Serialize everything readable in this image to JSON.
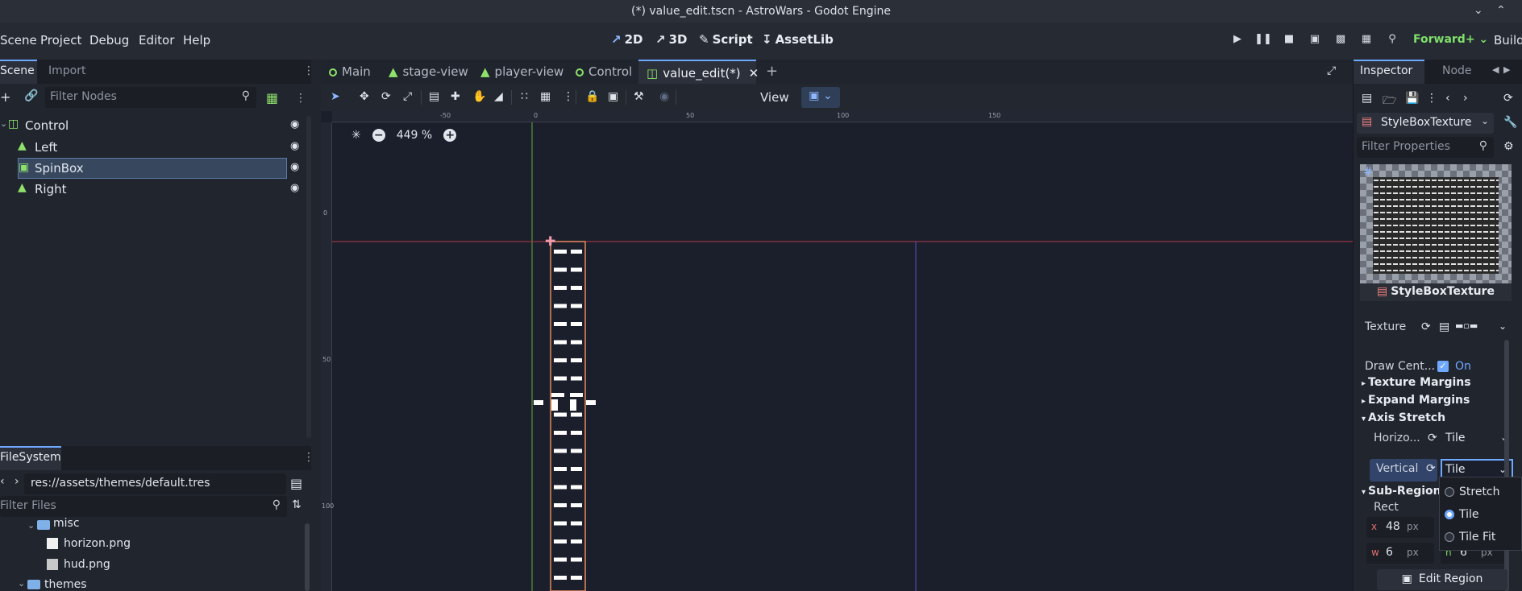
{
  "window": {
    "title": "(*) value_edit.tscn - AstroWars - Godot Engine"
  },
  "menu": {
    "items": [
      "Scene",
      "Project",
      "Debug",
      "Editor",
      "Help"
    ]
  },
  "workspaces": [
    {
      "label": "2D",
      "icon": "2d-icon"
    },
    {
      "label": "3D",
      "icon": "3d-icon"
    },
    {
      "label": "Script",
      "icon": "script-icon"
    },
    {
      "label": "AssetLib",
      "icon": "assetlib-icon"
    }
  ],
  "renderer": {
    "label": "Forward+"
  },
  "build": {
    "label": "Build"
  },
  "scene_dock": {
    "tabs": [
      "Scene",
      "Import"
    ],
    "filter_placeholder": "Filter Nodes",
    "nodes": [
      {
        "label": "Control",
        "icon": "control-node-icon",
        "depth": 0
      },
      {
        "label": "Left",
        "icon": "texture-rect-icon",
        "depth": 1
      },
      {
        "label": "SpinBox",
        "icon": "spinbox-icon",
        "depth": 1,
        "selected": true
      },
      {
        "label": "Right",
        "icon": "texture-rect-icon",
        "depth": 1
      }
    ]
  },
  "filesystem": {
    "tab": "FileSystem",
    "path": "res://assets/themes/default.tres",
    "filter_placeholder": "Filter Files",
    "items": [
      {
        "label": "misc",
        "type": "folder"
      },
      {
        "label": "horizon.png",
        "type": "image"
      },
      {
        "label": "hud.png",
        "type": "image"
      },
      {
        "label": "themes",
        "type": "folder"
      }
    ]
  },
  "scene_tabs": [
    {
      "label": "Main"
    },
    {
      "label": "stage-view"
    },
    {
      "label": "player-view"
    },
    {
      "label": "Control"
    },
    {
      "label": "value_edit(*)",
      "active": true
    }
  ],
  "editor_toolbar": {
    "view_label": "View"
  },
  "ruler": {
    "top_marks": [
      "-50",
      "0",
      "50",
      "100",
      "150"
    ],
    "left_marks": [
      "0",
      "50",
      "100"
    ]
  },
  "zoom": {
    "label": "449 %"
  },
  "inspector": {
    "tabs": [
      "Inspector",
      "Node"
    ],
    "resource": "StyleBoxTexture",
    "filter_placeholder": "Filter Properties",
    "preview_label": "StyleBoxTexture",
    "texture_label": "Texture",
    "draw_center": {
      "label": "Draw Cent...",
      "value": "On"
    },
    "sections": {
      "texture_margins": "Texture Margins",
      "expand_margins": "Expand Margins",
      "axis_stretch": "Axis Stretch",
      "sub_region": "Sub-Region"
    },
    "horizontal": {
      "label": "Horizo...",
      "value": "Tile"
    },
    "vertical": {
      "label": "Vertical",
      "value": "Tile"
    },
    "rect_label": "Rect",
    "rect": {
      "x": {
        "axis": "x",
        "value": "48",
        "unit": "px"
      },
      "w": {
        "axis": "w",
        "value": "6",
        "unit": "px"
      },
      "h": {
        "axis": "h",
        "value": "6",
        "unit": "px"
      }
    },
    "popup_options": [
      "Stretch",
      "Tile",
      "Tile Fit"
    ],
    "popup_selected": 1,
    "edit_region": "Edit Region"
  },
  "colors": {
    "accent": "#6fa8ff",
    "node_green": "#8ee26b",
    "selection": "#37475e"
  }
}
